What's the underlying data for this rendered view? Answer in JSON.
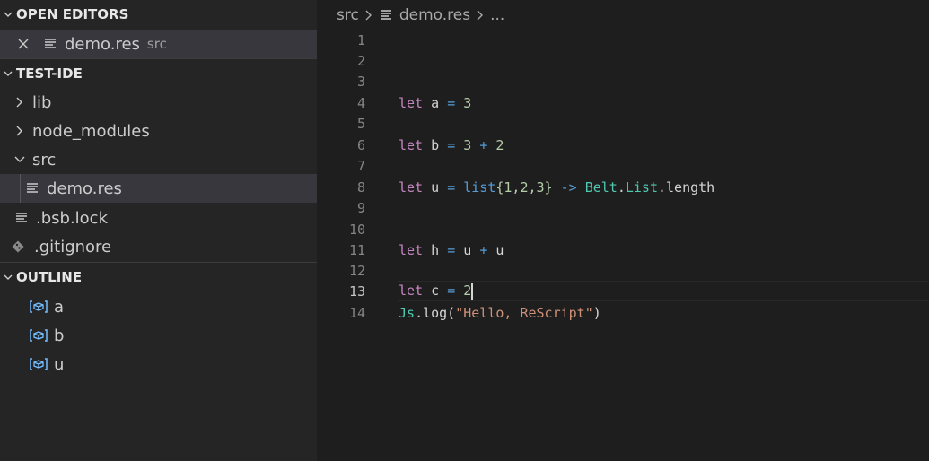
{
  "sidebar": {
    "open_editors": {
      "title": "OPEN EDITORS",
      "items": [
        {
          "name": "demo.res",
          "description": "src"
        }
      ]
    },
    "explorer": {
      "title": "TEST-IDE",
      "items": [
        {
          "label": "lib",
          "type": "folder",
          "expanded": false
        },
        {
          "label": "node_modules",
          "type": "folder",
          "expanded": false
        },
        {
          "label": "src",
          "type": "folder",
          "expanded": true
        },
        {
          "label": "demo.res",
          "type": "file"
        },
        {
          "label": ".bsb.lock",
          "type": "file"
        },
        {
          "label": ".gitignore",
          "type": "git-file"
        }
      ]
    },
    "outline": {
      "title": "OUTLINE",
      "items": [
        {
          "label": "a"
        },
        {
          "label": "b"
        },
        {
          "label": "u"
        }
      ]
    }
  },
  "editor": {
    "breadcrumb": {
      "folder": "src",
      "file": "demo.res",
      "rest": "..."
    },
    "line_numbers": [
      "1",
      "2",
      "3",
      "4",
      "5",
      "6",
      "7",
      "8",
      "9",
      "10",
      "11",
      "12",
      "13",
      "14"
    ],
    "active_line": 13,
    "tokens": {
      "let": "let",
      "eq": "=",
      "plus": "+",
      "arrow": "->",
      "a": "a",
      "b": "b",
      "u": "u",
      "h": "h",
      "c": "c",
      "three": "3",
      "two": "2",
      "list": "list",
      "list_body": "{1,2,3}",
      "belt": "Belt",
      "dot": ".",
      "list_mod": "List",
      "length": ".length",
      "js": "Js",
      "log": ".log(",
      "str": "\"Hello, ReScript\"",
      "close": ")"
    }
  },
  "colors": {
    "keyword": "#c586c0",
    "operator": "#569cd6",
    "number": "#b5cea8",
    "module": "#4ec9b0",
    "string": "#ce9178",
    "symbol_icon": "#75beff"
  }
}
